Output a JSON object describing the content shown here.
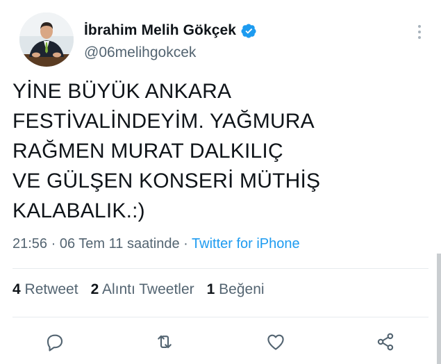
{
  "author": {
    "display_name": "İbrahim Melih Gökçek",
    "handle": "@06melihgokcek",
    "avatar_icon": "profile-photo",
    "verified_icon": "verified-badge-icon"
  },
  "tweet": {
    "lines": [
      "YİNE BÜYÜK ANKARA",
      "FESTİVALİNDEYİM. YAĞMURA",
      "RAĞMEN MURAT DALKILIÇ",
      "VE GÜLŞEN KONSERİ MÜTHİŞ",
      "KALABALIK.:)"
    ],
    "time": "21:56",
    "separator": "·",
    "date": "06 Tem 11 saatinde",
    "source": "Twitter for iPhone"
  },
  "stats": {
    "retweets_count": "4",
    "retweets_label": "Retweet",
    "quotes_count": "2",
    "quotes_label": "Alıntı Tweetler",
    "likes_count": "1",
    "likes_label": "Beğeni"
  },
  "actions": [
    "reply-icon",
    "retweet-icon",
    "like-icon",
    "share-icon"
  ],
  "colors": {
    "text": "#0f1419",
    "secondary": "#536471",
    "accent": "#1d9bf0",
    "divider": "#e6ebee"
  }
}
